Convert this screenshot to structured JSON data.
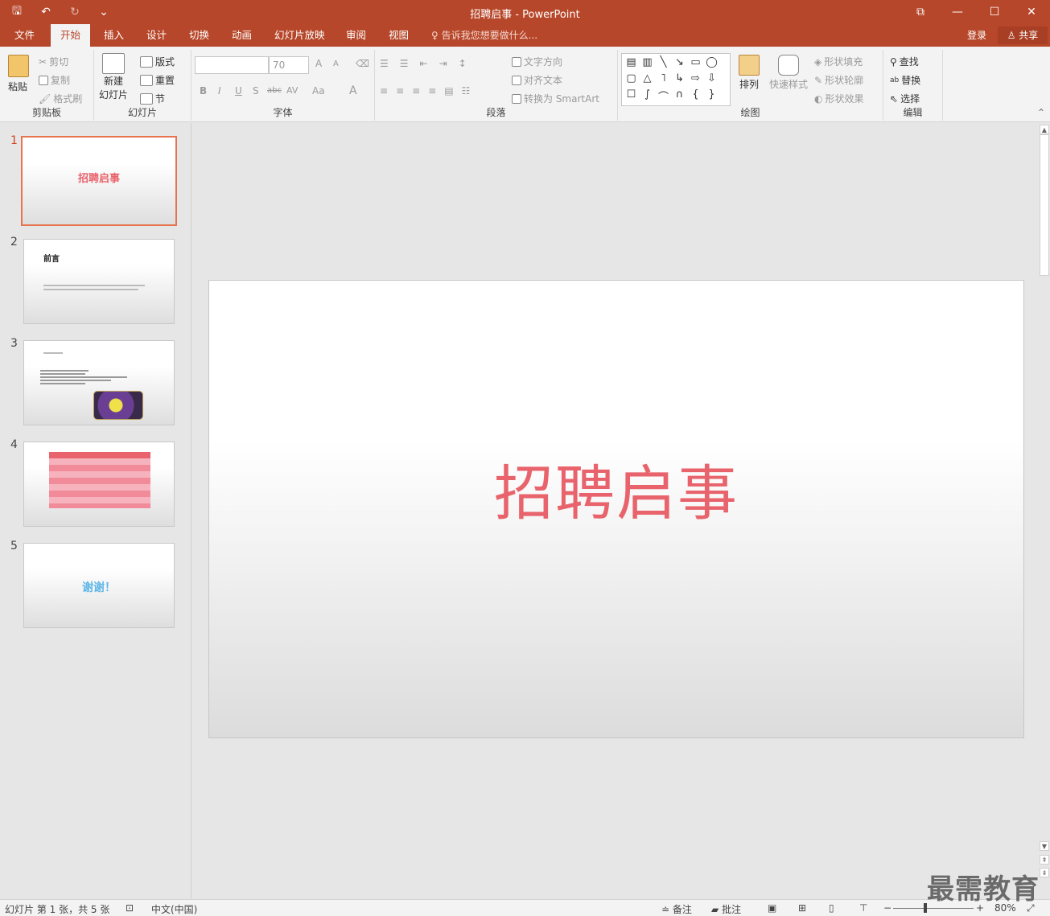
{
  "window": {
    "title": "招聘启事 - PowerPoint",
    "qat": {
      "save": "🖫",
      "undo": "↶",
      "redo": "↻",
      "customize": "⌄"
    },
    "controls": {
      "ribbon_display": "⧉",
      "minimize": "—",
      "maximize": "☐",
      "close": "✕"
    }
  },
  "tabs": [
    "文件",
    "开始",
    "插入",
    "设计",
    "切换",
    "动画",
    "幻灯片放映",
    "审阅",
    "视图"
  ],
  "active_tab": "开始",
  "tellme": "告诉我您想要做什么...",
  "account": {
    "login": "登录",
    "share": "共享"
  },
  "ribbon": {
    "clipboard": {
      "paste": "粘贴",
      "cut": "剪切",
      "copy": "复制",
      "format_painter": "格式刷",
      "label": "剪贴板"
    },
    "slides": {
      "new_slide_line1": "新建",
      "new_slide_line2": "幻灯片",
      "layout": "版式",
      "reset": "重置",
      "section": "节",
      "label": "幻灯片"
    },
    "font": {
      "font_name": "",
      "font_size": "70",
      "bold": "B",
      "italic": "I",
      "underline": "U",
      "shadow": "S",
      "strike": "abc",
      "spacing": "AV",
      "case": "Aa",
      "color": "A",
      "grow": "A",
      "shrink": "A",
      "label": "字体"
    },
    "paragraph": {
      "text_direction": "文字方向",
      "align_text": "对齐文本",
      "smartart": "转换为 SmartArt",
      "label": "段落"
    },
    "drawing": {
      "arrange": "排列",
      "quick_styles": "快速样式",
      "shape_fill": "形状填充",
      "shape_outline": "形状轮廓",
      "shape_effects": "形状效果",
      "label": "绘图"
    },
    "editing": {
      "find": "查找",
      "replace": "替换",
      "select": "选择",
      "label": "编辑"
    }
  },
  "slides": [
    {
      "number": "1",
      "title": "招聘启事"
    },
    {
      "number": "2",
      "title": "前言"
    },
    {
      "number": "3",
      "title": ""
    },
    {
      "number": "4",
      "title": ""
    },
    {
      "number": "5",
      "title": "谢谢！"
    }
  ],
  "current_slide": {
    "title": "招聘启事"
  },
  "statusbar": {
    "slide_info": "幻灯片 第 1 张，共 5 张",
    "language": "中文(中国)",
    "notes": "备注",
    "comments": "批注",
    "zoom": "80%"
  },
  "watermark": "最需教育",
  "colors": {
    "accent": "#b7472a",
    "title_red": "#e8636b",
    "thanks_blue": "#5fb7e8",
    "selection": "#e8734f"
  }
}
